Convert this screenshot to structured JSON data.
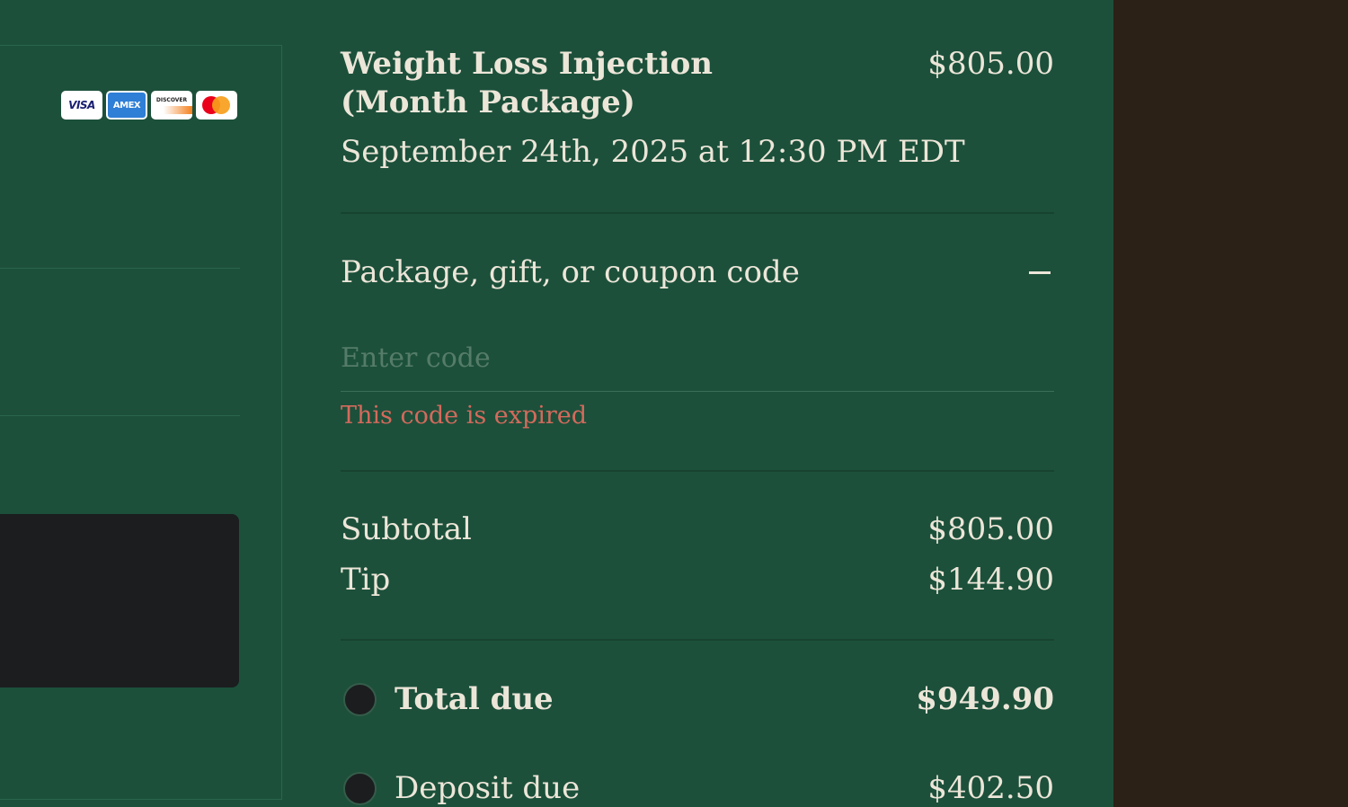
{
  "payment": {
    "card_logos": [
      {
        "name": "visa",
        "text": "VISA"
      },
      {
        "name": "amex",
        "text": "AMEX"
      },
      {
        "name": "discover",
        "text": "DISCOVER"
      },
      {
        "name": "mastercard",
        "text": ""
      }
    ]
  },
  "order": {
    "item_title": "Weight Loss Injection (Month Package)",
    "item_price": "$805.00",
    "item_datetime": "September 24th, 2025 at 12:30 PM EDT"
  },
  "coupon": {
    "label": "Package, gift, or coupon code",
    "toggle_icon": "minus-icon",
    "input_value": "",
    "input_placeholder": "Enter code",
    "error": "This code is expired"
  },
  "totals": {
    "subtotal_label": "Subtotal",
    "subtotal_value": "$805.00",
    "tip_label": "Tip",
    "tip_value": "$144.90"
  },
  "due_options": [
    {
      "label": "Total due",
      "value": "$949.90",
      "selected": false
    },
    {
      "label": "Deposit due",
      "value": "$402.50",
      "selected": false
    }
  ],
  "colors": {
    "panel_bg": "#1c503b",
    "page_bg": "#2c2117",
    "text": "#ece6d8",
    "error": "#d46a5c",
    "placeholder": "#557c68",
    "dark_box": "#1b1d1f"
  }
}
